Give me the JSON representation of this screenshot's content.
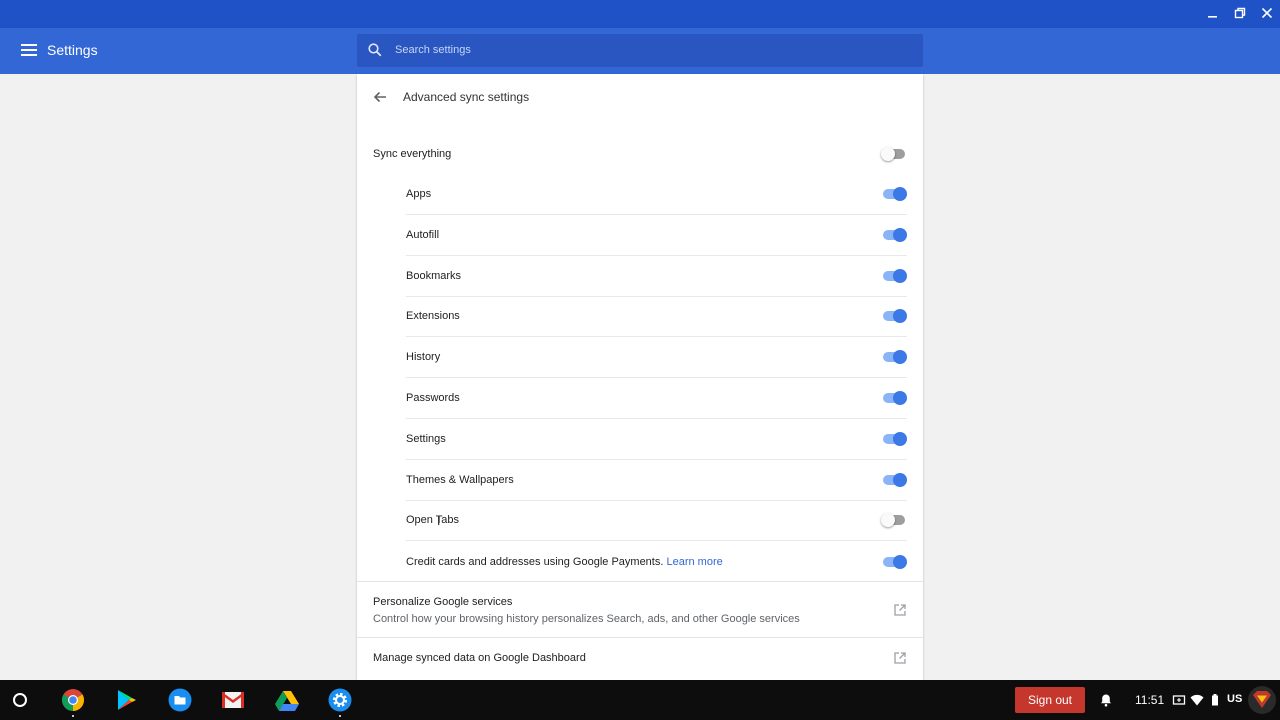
{
  "window": {
    "minimize_icon": "minimize-icon",
    "restore_icon": "restore-icon",
    "close_icon": "close-icon"
  },
  "header": {
    "title": "Settings",
    "search_placeholder": "Search settings"
  },
  "subpage": {
    "title": "Advanced sync settings",
    "sync_everything": {
      "label": "Sync everything",
      "on": false
    },
    "items": [
      {
        "label": "Apps",
        "on": true
      },
      {
        "label": "Autofill",
        "on": true
      },
      {
        "label": "Bookmarks",
        "on": true
      },
      {
        "label": "Extensions",
        "on": true
      },
      {
        "label": "History",
        "on": true
      },
      {
        "label": "Passwords",
        "on": true
      },
      {
        "label": "Settings",
        "on": true
      },
      {
        "label": "Themes & Wallpapers",
        "on": true
      },
      {
        "label": "Open Tabs",
        "on": false
      },
      {
        "label": "Credit cards and addresses using Google Payments.",
        "learn_more": "Learn more",
        "on": true
      }
    ],
    "links": [
      {
        "title": "Personalize Google services",
        "description": "Control how your browsing history personalizes Search, ads, and other Google services"
      },
      {
        "title": "Manage synced data on Google Dashboard"
      }
    ]
  },
  "shelf": {
    "apps": [
      "chrome-icon",
      "play-store-icon",
      "files-icon",
      "gmail-icon",
      "drive-icon",
      "settings-icon"
    ],
    "sign_out": "Sign out",
    "time": "11:51",
    "keyboard_layout": "US"
  },
  "colors": {
    "accent": "#3367d6",
    "titlebar": "#1e52c6",
    "toggle_on": "#3c78e6",
    "sign_out": "#c5372c"
  }
}
